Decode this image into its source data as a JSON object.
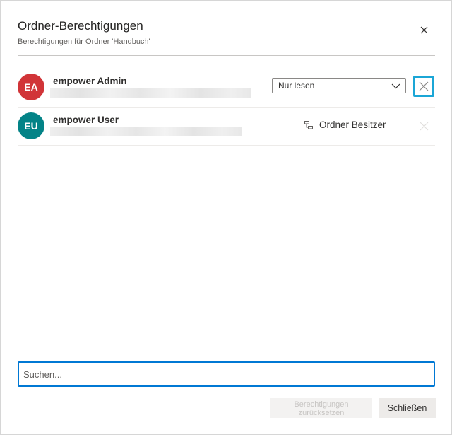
{
  "dialog": {
    "title": "Ordner-Berechtigungen",
    "subtitle": "Berechtigungen für Ordner 'Handbuch'"
  },
  "users": [
    {
      "initials": "EA",
      "name": "empower Admin",
      "avatar_color": "#d13438",
      "permission": "Nur lesen"
    },
    {
      "initials": "EU",
      "name": "empower User",
      "avatar_color": "#038387",
      "role": "Ordner Besitzer"
    }
  ],
  "search": {
    "placeholder": "Suchen...",
    "value": ""
  },
  "footer": {
    "reset_label_line1": "Berechtigungen",
    "reset_label_line2": "zurücksetzen",
    "close_label": "Schließen"
  },
  "colors": {
    "accent": "#0078d4",
    "focus_highlight": "#1ba6d6"
  },
  "icons": {
    "close": "close-icon",
    "chevron": "chevron-down-icon",
    "remove": "remove-icon",
    "owner": "hierarchy-icon"
  }
}
